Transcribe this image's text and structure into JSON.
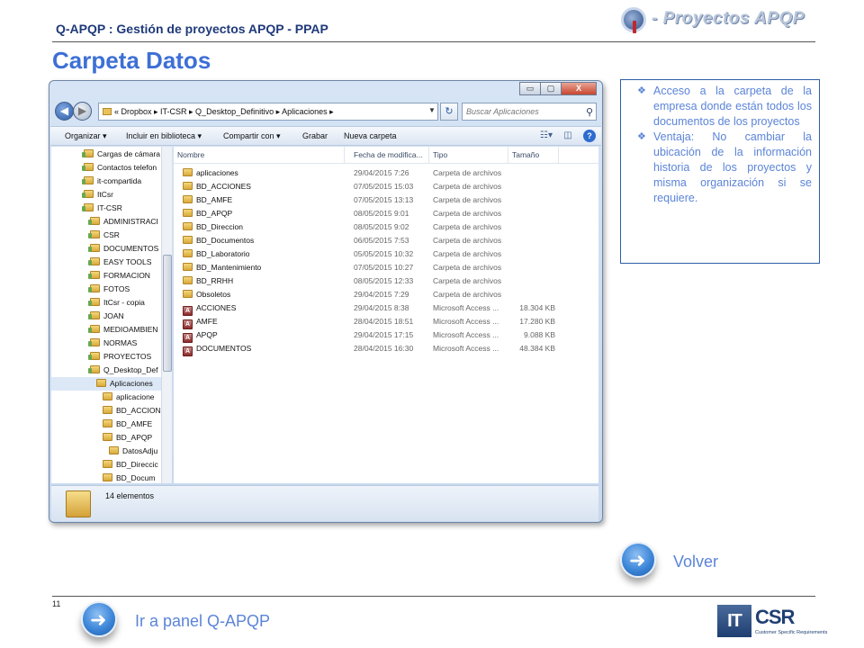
{
  "header": {
    "title": "Q-APQP : Gestión de proyectos APQP - PPAP",
    "logo_text": "- Proyectos APQP"
  },
  "page_heading": "Carpeta Datos",
  "window": {
    "controls": [
      "▭",
      "▢",
      "X"
    ],
    "address": "« Dropbox ▸ IT-CSR ▸ Q_Desktop_Definitivo ▸ Aplicaciones ▸",
    "search_placeholder": "Buscar Aplicaciones",
    "toolbar": {
      "organize": "Organizar ▾",
      "include_library": "Incluir en biblioteca ▾",
      "share_with": "Compartir con ▾",
      "burn": "Grabar",
      "new_folder": "Nueva carpeta"
    },
    "nav_tree": [
      {
        "label": "Cargas de cámara",
        "indent": 0
      },
      {
        "label": "Contactos telefon",
        "indent": 0
      },
      {
        "label": "it-compartida",
        "indent": 0
      },
      {
        "label": "ItCsr",
        "indent": 0
      },
      {
        "label": "IT-CSR",
        "indent": 0
      },
      {
        "label": "ADMINISTRACI",
        "indent": 1
      },
      {
        "label": "CSR",
        "indent": 1
      },
      {
        "label": "DOCUMENTOS",
        "indent": 1
      },
      {
        "label": "EASY TOOLS",
        "indent": 1
      },
      {
        "label": "FORMACION",
        "indent": 1
      },
      {
        "label": "FOTOS",
        "indent": 1
      },
      {
        "label": "ItCsr - copia",
        "indent": 1
      },
      {
        "label": "JOAN",
        "indent": 1
      },
      {
        "label": "MEDIOAMBIEN",
        "indent": 1
      },
      {
        "label": "NORMAS",
        "indent": 1
      },
      {
        "label": "PROYECTOS",
        "indent": 1
      },
      {
        "label": "Q_Desktop_Def",
        "indent": 1
      },
      {
        "label": "Aplicaciones",
        "indent": 2,
        "selected": true
      },
      {
        "label": "aplicacione",
        "indent": 3
      },
      {
        "label": "BD_ACCION",
        "indent": 3
      },
      {
        "label": "BD_AMFE",
        "indent": 3
      },
      {
        "label": "BD_APQP",
        "indent": 3
      },
      {
        "label": "DatosAdju",
        "indent": 4
      },
      {
        "label": "BD_Direccic",
        "indent": 3
      },
      {
        "label": "BD_Docum",
        "indent": 3
      }
    ],
    "columns": {
      "name": "Nombre",
      "modified": "Fecha de modifica...",
      "type": "Tipo",
      "size": "Tamaño"
    },
    "files": [
      {
        "name": "aplicaciones",
        "date": "29/04/2015 7:26",
        "type": "Carpeta de archivos",
        "size": "",
        "kind": "folder"
      },
      {
        "name": "BD_ACCIONES",
        "date": "07/05/2015 15:03",
        "type": "Carpeta de archivos",
        "size": "",
        "kind": "folder"
      },
      {
        "name": "BD_AMFE",
        "date": "07/05/2015 13:13",
        "type": "Carpeta de archivos",
        "size": "",
        "kind": "folder"
      },
      {
        "name": "BD_APQP",
        "date": "08/05/2015 9:01",
        "type": "Carpeta de archivos",
        "size": "",
        "kind": "folder"
      },
      {
        "name": "BD_Direccion",
        "date": "08/05/2015 9:02",
        "type": "Carpeta de archivos",
        "size": "",
        "kind": "folder"
      },
      {
        "name": "BD_Documentos",
        "date": "06/05/2015 7:53",
        "type": "Carpeta de archivos",
        "size": "",
        "kind": "folder"
      },
      {
        "name": "BD_Laboratorio",
        "date": "05/05/2015 10:32",
        "type": "Carpeta de archivos",
        "size": "",
        "kind": "folder"
      },
      {
        "name": "BD_Mantenimiento",
        "date": "07/05/2015 10:27",
        "type": "Carpeta de archivos",
        "size": "",
        "kind": "folder"
      },
      {
        "name": "BD_RRHH",
        "date": "08/05/2015 12:33",
        "type": "Carpeta de archivos",
        "size": "",
        "kind": "folder"
      },
      {
        "name": "Obsoletos",
        "date": "29/04/2015 7:29",
        "type": "Carpeta de archivos",
        "size": "",
        "kind": "folder"
      },
      {
        "name": "ACCIONES",
        "date": "29/04/2015 8:38",
        "type": "Microsoft Access ...",
        "size": "18.304 KB",
        "kind": "access"
      },
      {
        "name": "AMFE",
        "date": "28/04/2015 18:51",
        "type": "Microsoft Access ...",
        "size": "17.280 KB",
        "kind": "access"
      },
      {
        "name": "APQP",
        "date": "29/04/2015 17:15",
        "type": "Microsoft Access ...",
        "size": "9.088 KB",
        "kind": "access"
      },
      {
        "name": "DOCUMENTOS",
        "date": "28/04/2015 16:30",
        "type": "Microsoft Access ...",
        "size": "48.384 KB",
        "kind": "access"
      }
    ],
    "status": "14 elementos"
  },
  "notes": [
    "Acceso a la carpeta de la empresa donde están todos los documentos de los proyectos",
    "Ventaja: No cambiar la ubicación de la información historia de los proyectos y misma organización si se requiere."
  ],
  "buttons": {
    "volver": "Volver",
    "panel": "Ir a panel Q-APQP"
  },
  "slide_number": "11",
  "footer_logo": {
    "it": "IT",
    "csr": "CSR",
    "tagline": "Customer Specific Requirements"
  }
}
